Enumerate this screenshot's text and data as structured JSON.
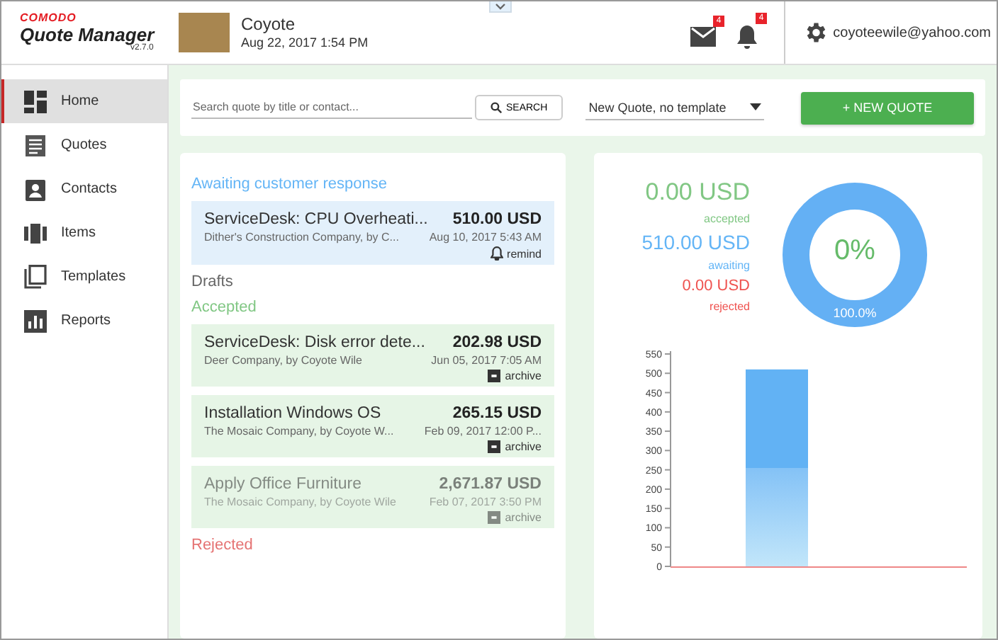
{
  "app": {
    "brand": "COMODO",
    "name": "Quote Manager",
    "version": "v2.7.0"
  },
  "user": {
    "name": "Coyote",
    "datetime": "Aug 22, 2017 1:54 PM",
    "email": "coyoteewile@yahoo.com"
  },
  "notifications": [
    {
      "kind": "mail",
      "count": "4"
    },
    {
      "kind": "bell",
      "count": "4"
    }
  ],
  "sidebar": {
    "items": [
      {
        "label": "Home",
        "kind": "home",
        "selected": true
      },
      {
        "label": "Quotes",
        "kind": "quotes",
        "selected": false
      },
      {
        "label": "Contacts",
        "kind": "contacts",
        "selected": false
      },
      {
        "label": "Items",
        "kind": "items",
        "selected": false
      },
      {
        "label": "Templates",
        "kind": "templates",
        "selected": false
      },
      {
        "label": "Reports",
        "kind": "reports",
        "selected": false
      }
    ]
  },
  "toolbar": {
    "search": {
      "placeholder": "Search quote by title or contact..."
    },
    "search_button": "SEARCH",
    "template_select": "New Quote, no template",
    "new_button": "+ NEW QUOTE"
  },
  "sections": [
    {
      "title": "Awaiting customer response",
      "kind": "awaiting",
      "items": [
        {
          "title": "ServiceDesk: CPU Overheati...",
          "company": "Dither's Construction Company, by C...",
          "amount": "510.00 USD",
          "date": "Aug 10, 2017 5:43 AM",
          "action": "remind",
          "kind": "remind",
          "faded": false
        }
      ]
    },
    {
      "title": "Drafts",
      "kind": "drafts"
    },
    {
      "title": "Accepted",
      "kind": "accepted",
      "items": [
        {
          "title": "ServiceDesk: Disk error dete...",
          "company": "Deer Company, by Coyote Wile",
          "amount": "202.98 USD",
          "date": "Jun 05, 2017 7:05 AM",
          "action": "archive",
          "kind": "archive",
          "faded": false
        },
        {
          "title": "Installation Windows OS",
          "company": "The Mosaic Company, by Coyote W...",
          "amount": "265.15 USD",
          "date": "Feb 09, 2017 12:00 P...",
          "action": "archive",
          "kind": "archive",
          "faded": false
        },
        {
          "title": "Apply Office Furniture",
          "company": "The Mosaic Company, by Coyote Wile",
          "amount": "2,671.87 USD",
          "date": "Feb 07, 2017 3:50 PM",
          "action": "archive",
          "kind": "archive",
          "faded": true
        }
      ]
    },
    {
      "title": "Rejected",
      "kind": "rejected"
    }
  ],
  "stats": [
    {
      "amount": "0.00 USD",
      "label": "accepted",
      "kind": "accepted"
    },
    {
      "amount": "510.00 USD",
      "label": "awaiting",
      "kind": "awaiting"
    },
    {
      "amount": "0.00 USD",
      "label": "rejected",
      "kind": "rejected"
    }
  ],
  "donut": {
    "center": "0%",
    "ring_label": "100.0%"
  },
  "bar_chart": {
    "chart_data": {
      "type": "bar",
      "values": [
        510
      ],
      "ylim": [
        0,
        550
      ],
      "yticks": [
        0,
        50,
        100,
        150,
        200,
        250,
        300,
        350,
        400,
        450,
        500,
        550
      ]
    }
  }
}
